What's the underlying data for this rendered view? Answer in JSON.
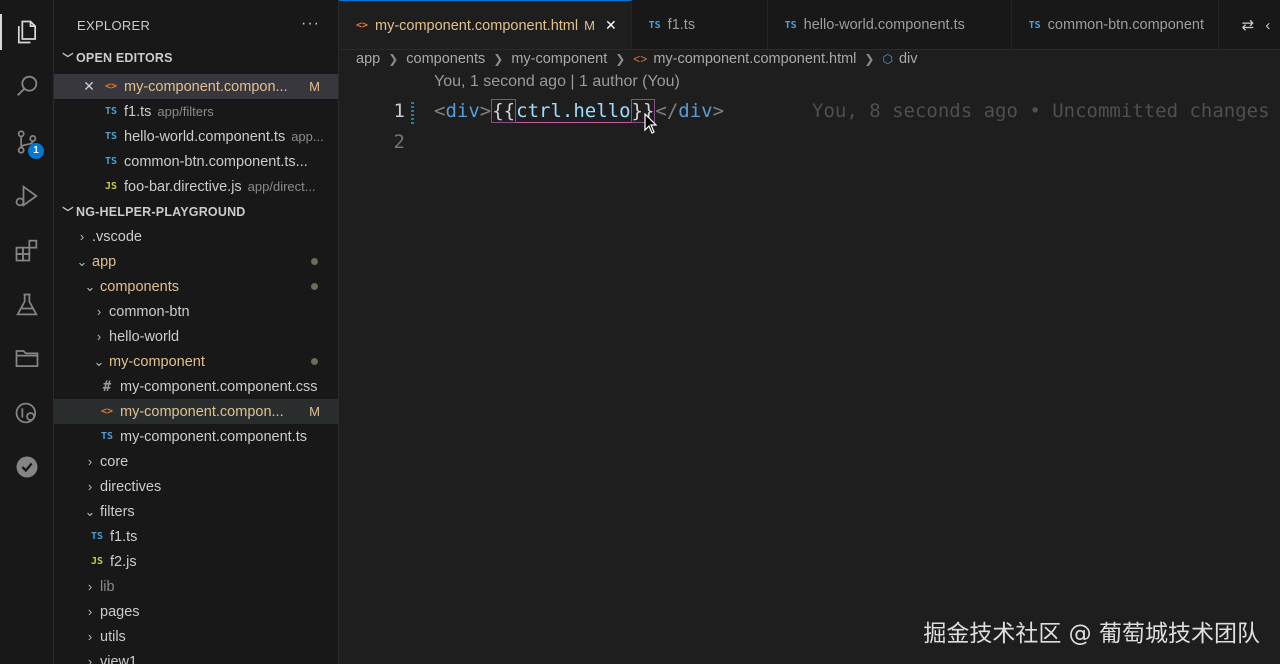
{
  "sidebar": {
    "title": "EXPLORER",
    "more": "···",
    "open_editors_label": "OPEN EDITORS",
    "open_editors": [
      {
        "icon": "<>",
        "name": "my-component.compon...",
        "desc": "",
        "mod": "M"
      },
      {
        "icon": "TS",
        "name": "f1.ts",
        "desc": "app/filters",
        "mod": ""
      },
      {
        "icon": "TS",
        "name": "hello-world.component.ts",
        "desc": "app...",
        "mod": ""
      },
      {
        "icon": "TS",
        "name": "common-btn.component.ts...",
        "desc": "",
        "mod": ""
      },
      {
        "icon": "JS",
        "name": "foo-bar.directive.js",
        "desc": "app/direct...",
        "mod": ""
      }
    ],
    "workspace_label": "NG-HELPER-PLAYGROUND",
    "tree": [
      {
        "name": ".vscode"
      },
      {
        "name": "app"
      },
      {
        "name": "components"
      },
      {
        "name": "common-btn"
      },
      {
        "name": "hello-world"
      },
      {
        "name": "my-component"
      },
      {
        "name": "my-component.component.css",
        "icon": "#"
      },
      {
        "name": "my-component.compon...",
        "icon": "<>",
        "mod": "M"
      },
      {
        "name": "my-component.component.ts",
        "icon": "TS"
      },
      {
        "name": "core"
      },
      {
        "name": "directives"
      },
      {
        "name": "filters"
      },
      {
        "name": "f1.ts",
        "icon": "TS"
      },
      {
        "name": "f2.js",
        "icon": "JS"
      },
      {
        "name": "lib"
      },
      {
        "name": "pages"
      },
      {
        "name": "utils"
      },
      {
        "name": "view1"
      }
    ]
  },
  "activity": {
    "scm_badge": "1"
  },
  "tabs": [
    {
      "icon": "<>",
      "label": "my-component.component.html",
      "mod": "M",
      "close": "✕"
    },
    {
      "icon": "TS",
      "label": "f1.ts"
    },
    {
      "icon": "TS",
      "label": "hello-world.component.ts"
    },
    {
      "icon": "TS",
      "label": "common-btn.component"
    }
  ],
  "breadcrumb": [
    "app",
    "components",
    "my-component",
    "my-component.component.html",
    "div"
  ],
  "editor": {
    "blame_header": "You, 1 second ago | 1 author (You)",
    "line_numbers": [
      "1",
      "2"
    ],
    "code": {
      "open_tag_lt": "<",
      "open_tag_name": "div",
      "open_tag_gt": ">",
      "brace_open": "{{",
      "expr": "ctrl.hello",
      "brace_close": "}}",
      "close_tag_lt": "</",
      "close_tag_name": "div",
      "close_tag_gt": ">"
    },
    "inline_blame": "You, 8 seconds ago • Uncommitted changes"
  },
  "watermark": "掘金技术社区 @ 葡萄城技术团队",
  "colors": {
    "accent": "#0078d4",
    "modified": "#e2c08d",
    "tag": "#569cd6",
    "identifier": "#9cdcfe"
  }
}
